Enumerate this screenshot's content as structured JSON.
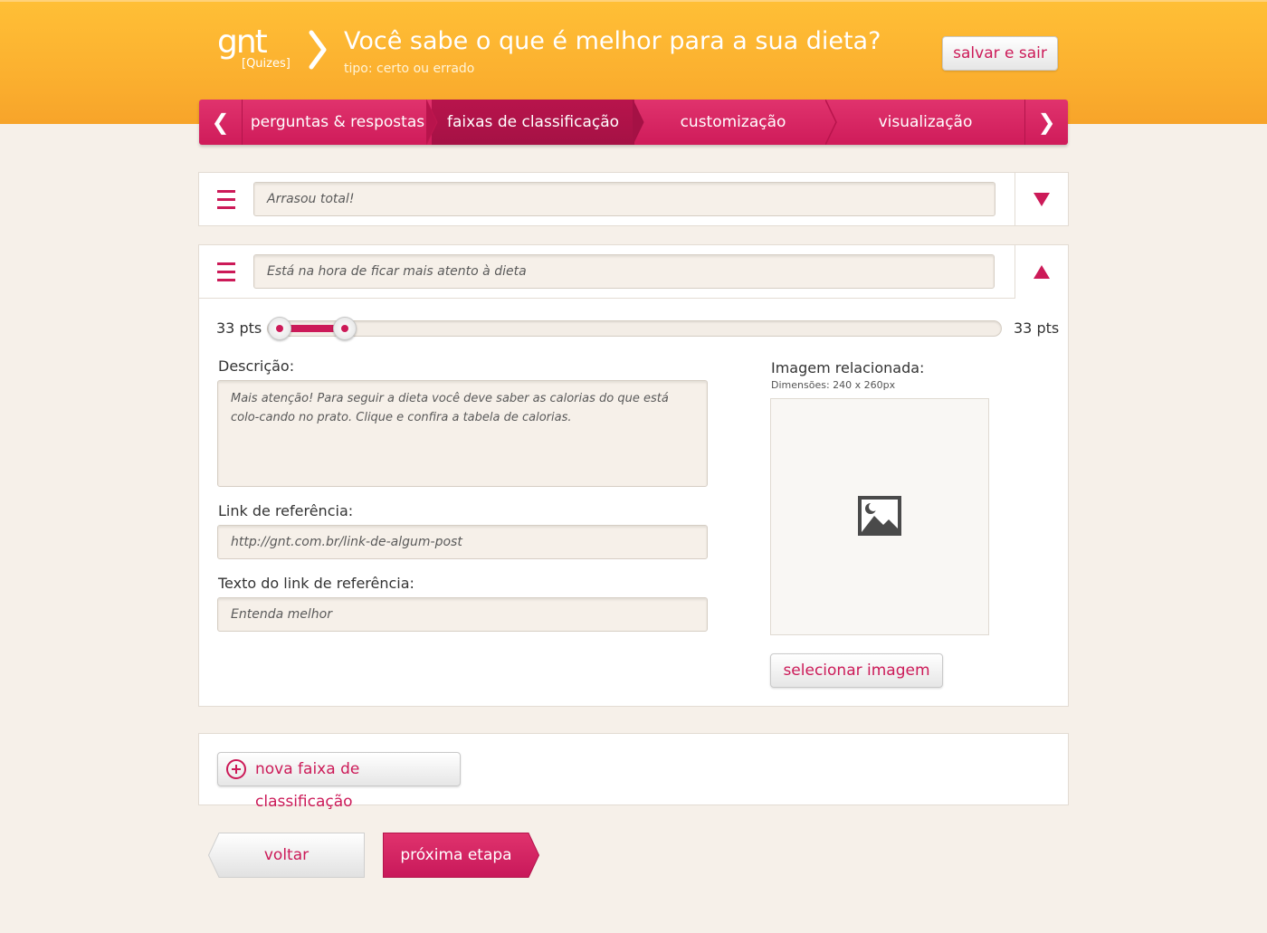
{
  "header": {
    "logo_text": "gnt",
    "logo_sub": "[Quizes]",
    "title": "Você sabe o que é melhor para a sua dieta?",
    "subtitle": "tipo: certo ou errado",
    "save_exit_label": "salvar e sair"
  },
  "tabs": [
    {
      "label": "perguntas & respostas",
      "active": false
    },
    {
      "label": "faixas de classificação",
      "active": true
    },
    {
      "label": "customização",
      "active": false
    },
    {
      "label": "visualização",
      "active": false
    }
  ],
  "ranges": [
    {
      "title": "Arrasou total!",
      "expanded": false
    },
    {
      "title": "Está na hora de ficar mais atento à dieta",
      "expanded": true
    }
  ],
  "slider": {
    "min_label": "33 pts",
    "max_label": "33 pts",
    "start_fraction": 0.016,
    "end_fraction": 0.105
  },
  "form": {
    "description_label": "Descrição:",
    "description_value": "Mais atenção! Para seguir a dieta você deve saber as calorias do que está colo-cando no prato. Clique e confira a tabela de calorias.",
    "link_label": "Link de referência:",
    "link_value": "http://gnt.com.br/link-de-algum-post",
    "link_text_label": "Texto do link de referência:",
    "link_text_value": "Entenda melhor"
  },
  "image": {
    "label": "Imagem relacionada:",
    "dimensions": "Dimensões: 240 x 260px",
    "icon": "image-placeholder-icon",
    "select_label": "selecionar imagem"
  },
  "add_range_label": "nova faixa de classificação",
  "footer": {
    "back_label": "voltar",
    "next_label": "próxima etapa"
  },
  "colors": {
    "accent": "#cc1a58",
    "header_orange": "#fbb02f",
    "background": "#f6f0e9"
  }
}
